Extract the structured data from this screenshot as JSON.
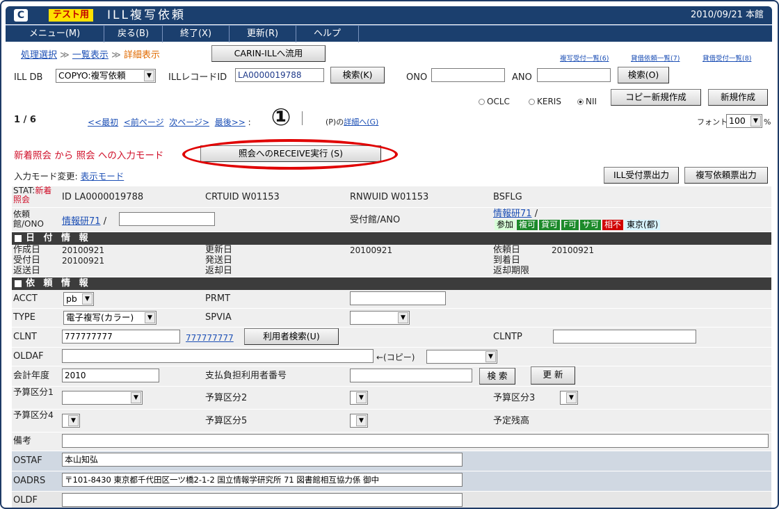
{
  "titlebar": {
    "logo": "C",
    "test_badge": "テスト用",
    "title": "ILL複写依頼",
    "date_branch": "2010/09/21 本館"
  },
  "menu": [
    "メニュー(M)",
    "戻る(B)",
    "終了(X)",
    "更新(R)",
    "ヘルプ"
  ],
  "breadcrumb": {
    "step1": "処理選択",
    "step2": "一覧表示",
    "step3": "詳細表示",
    "sep": "≫"
  },
  "carin_button": "CARIN-ILLへ流用",
  "right_links": [
    "複写受付一覧(6)",
    "貸借依頼一覧(7)",
    "貸借受付一覧(8)"
  ],
  "search": {
    "illdb_label": "ILL DB",
    "illdb_value": "COPYO:複写依頼",
    "record_label": "ILLレコードID",
    "record_value": "LA0000019788",
    "search_k": "検索(K)",
    "ono_label": "ONO",
    "ano_label": "ANO",
    "search_o": "検索(O)"
  },
  "radios": {
    "oclc": "OCLC",
    "keris": "KERIS",
    "nii": "NII",
    "selected": "nii"
  },
  "copy_new_button": "コピー新規作成",
  "new_button": "新規作成",
  "pager": {
    "position": "1 / 6",
    "first": "<<最初",
    "prev": "<前ページ",
    "next": "次ページ>",
    "last": "最後>>",
    "colon": ":",
    "suffix": "(P)の",
    "detail": "詳細へ(G)"
  },
  "annotation": "①",
  "font": {
    "label": "フォント",
    "value": "100",
    "unit": "%"
  },
  "mode_text": "新着照会 から 照会 への入力モード",
  "receive_button": "照会へのRECEIVE実行 (S)",
  "mode_change_label": "入力モード変更:",
  "mode_change_link": "表示モード",
  "ill_receipt_button": "ILL受付票出力",
  "copy_request_button": "複写依頼票出力",
  "stat": {
    "label": "STAT:",
    "value": "新着照会",
    "id": "ID LA0000019788",
    "crtuid": "CRTUID W01153",
    "rnwuid": "RNWUID W01153",
    "bsflg": "BSFLG"
  },
  "req": {
    "label": "依頼館/ONO",
    "lib_link": "情報研71",
    "slash": "/",
    "recv_label": "受付館/ANO",
    "recv_link": "情報研71",
    "recv_slash": "/",
    "tags": [
      {
        "text": "参加",
        "color": "#d8ffd8",
        "fg": "#000"
      },
      {
        "text": "複可",
        "color": "#1c8a2a",
        "fg": "#fff"
      },
      {
        "text": "貸可",
        "color": "#1c8a2a",
        "fg": "#fff"
      },
      {
        "text": "F可",
        "color": "#1c8a2a",
        "fg": "#fff"
      },
      {
        "text": "サ可",
        "color": "#1c8a2a",
        "fg": "#fff"
      },
      {
        "text": "相不",
        "color": "#d00000",
        "fg": "#fff"
      },
      {
        "text": "東京(都)",
        "color": "#d8f4ff",
        "fg": "#000"
      }
    ]
  },
  "date_section": "日 付 情 報",
  "dates": {
    "created_label": "作成日",
    "created": "20100921",
    "updated_label": "更新日",
    "updated": "20100921",
    "request_label": "依頼日",
    "request": "20100921",
    "received_label": "受付日",
    "received": "20100921",
    "sent_label": "発送日",
    "arrived_label": "到着日",
    "returned_label": "返送日",
    "return_label": "返却日",
    "return_due_label": "返却期限"
  },
  "req_section": "依 頼 情 報",
  "form": {
    "acct_label": "ACCT",
    "acct_value": "pb",
    "prmt_label": "PRMT",
    "type_label": "TYPE",
    "type_value": "電子複写(カラー)",
    "spvia_label": "SPVIA",
    "clnt_label": "CLNT",
    "clnt_value": "777777777",
    "clnt_link": "777777777",
    "user_search": "利用者検索(U)",
    "clntp_label": "CLNTP",
    "oldaf_label": "OLDAF",
    "copy_arrow": "←(コピー)",
    "fiscal_label": "会計年度",
    "fiscal_value": "2010",
    "payer_label": "支払負担利用者番号",
    "search_btn": "検 索",
    "update_btn": "更 新",
    "budget1_label": "予算区分1",
    "budget2_label": "予算区分2",
    "budget3_label": "予算区分3",
    "budget4_label": "予算区分4",
    "budget5_label": "予算区分5",
    "balance_label": "予定残高",
    "note_label": "備考",
    "ostaf_label": "OSTAF",
    "ostaf_value": "本山知弘",
    "oadrs_label": "OADRS",
    "oadrs_value": "〒101-8430 東京都千代田区一ツ橋2-1-2 国立情報学研究所 71 図書館相互協力係 御中",
    "oldf_label": "OLDF"
  }
}
